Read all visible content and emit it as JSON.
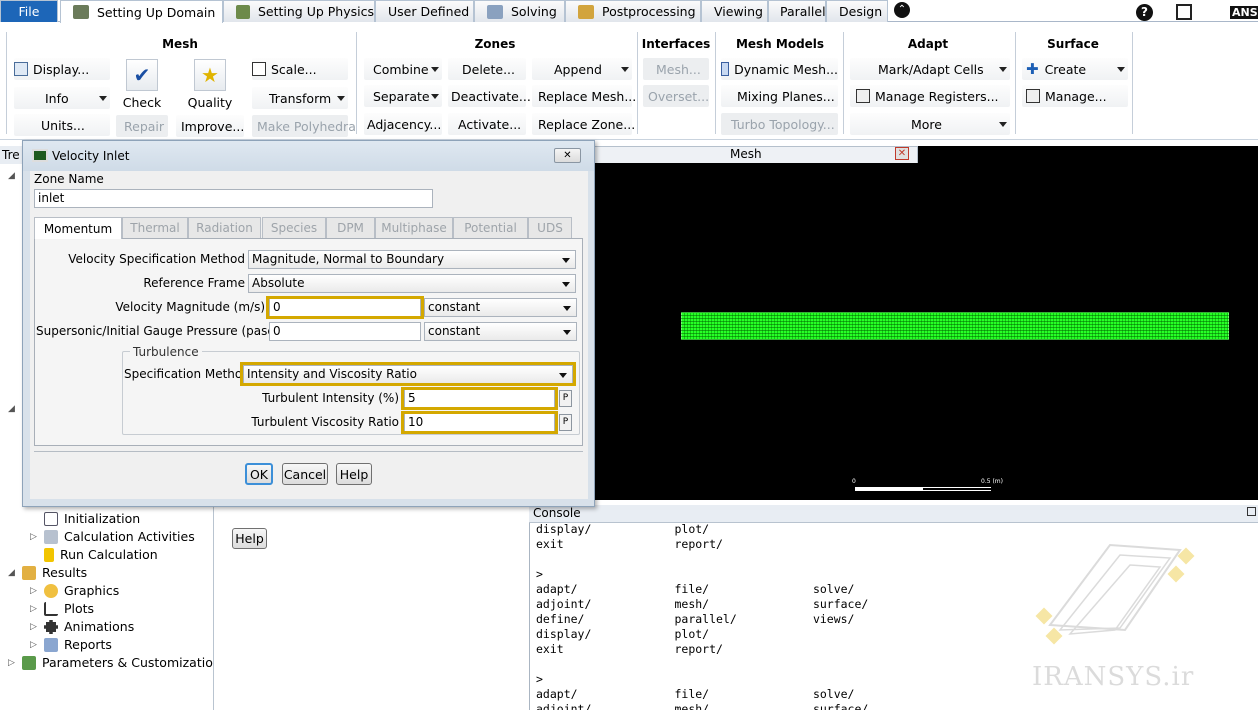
{
  "tabs": [
    {
      "label": "File"
    },
    {
      "label": "Setting Up Domain"
    },
    {
      "label": "Setting Up Physics"
    },
    {
      "label": "User Defined"
    },
    {
      "label": "Solving"
    },
    {
      "label": "Postprocessing"
    },
    {
      "label": "Viewing"
    },
    {
      "label": "Parallel"
    },
    {
      "label": "Design"
    }
  ],
  "top_right": {
    "help": "?",
    "brand": "ANS"
  },
  "ribbon": {
    "mesh": {
      "title": "Mesh",
      "display": "Display...",
      "info": "Info",
      "units": "Units...",
      "check": "Check",
      "repair": "Repair",
      "quality": "Quality",
      "improve": "Improve...",
      "scale": "Scale...",
      "transform": "Transform",
      "make_polyhedra": "Make Polyhedra"
    },
    "zones": {
      "title": "Zones",
      "combine": "Combine",
      "separate": "Separate",
      "adjacency": "Adjacency...",
      "delete": "Delete...",
      "deactivate": "Deactivate...",
      "activate": "Activate...",
      "append": "Append",
      "replace_mesh": "Replace Mesh...",
      "replace_zone": "Replace Zone..."
    },
    "interfaces": {
      "title": "Interfaces",
      "mesh": "Mesh...",
      "overset": "Overset..."
    },
    "mesh_models": {
      "title": "Mesh Models",
      "dynamic_mesh": "Dynamic Mesh...",
      "mixing_planes": "Mixing Planes...",
      "turbo_topology": "Turbo Topology..."
    },
    "adapt": {
      "title": "Adapt",
      "mark_adapt": "Mark/Adapt Cells",
      "manage_registers": "Manage Registers...",
      "more": "More"
    },
    "surface": {
      "title": "Surface",
      "create": "Create",
      "manage": "Manage..."
    }
  },
  "tree": {
    "truncated_header": "Tre",
    "items": [
      "Initialization",
      "Calculation Activities",
      "Run Calculation",
      "Results",
      "Graphics",
      "Plots",
      "Animations",
      "Reports",
      "Parameters & Customization"
    ],
    "help": "Help"
  },
  "mesh_window": {
    "tab": "Mesh",
    "scale_label": "0.5 (m)",
    "scale_zero": "0"
  },
  "console": {
    "title": "Console",
    "lines": [
      "display/            plot/",
      "exit                report/",
      "",
      ">",
      "adapt/              file/               solve/",
      "adjoint/            mesh/               surface/",
      "define/             parallel/           views/",
      "display/            plot/",
      "exit                report/",
      "",
      ">",
      "adapt/              file/               solve/",
      "adjoint/            mesh/               surface/"
    ]
  },
  "watermark": "IRANSYS.ir",
  "dialog": {
    "title": "Velocity Inlet",
    "zone_name_label": "Zone Name",
    "zone_name": "inlet",
    "tabs": [
      "Momentum",
      "Thermal",
      "Radiation",
      "Species",
      "DPM",
      "Multiphase",
      "Potential",
      "UDS"
    ],
    "velocity_spec_label": "Velocity Specification Method",
    "velocity_spec": "Magnitude, Normal to Boundary",
    "reference_frame_label": "Reference Frame",
    "reference_frame": "Absolute",
    "velocity_magnitude_label": "Velocity Magnitude (m/s)",
    "velocity_magnitude": "0",
    "velocity_magnitude_mode": "constant",
    "pressure_label": "Supersonic/Initial Gauge Pressure (pascal)",
    "pressure": "0",
    "pressure_mode": "constant",
    "turbulence_label": "Turbulence",
    "spec_method_label": "Specification Method",
    "spec_method": "Intensity and Viscosity Ratio",
    "intensity_label": "Turbulent Intensity (%)",
    "intensity": "5",
    "viscosity_ratio_label": "Turbulent Viscosity Ratio",
    "viscosity_ratio": "10",
    "p_button": "P",
    "ok": "OK",
    "cancel": "Cancel",
    "help": "Help"
  },
  "colors": {
    "highlight": "#d4a800",
    "mesh_green": "#21e021",
    "file_tab": "#1d66b8"
  }
}
